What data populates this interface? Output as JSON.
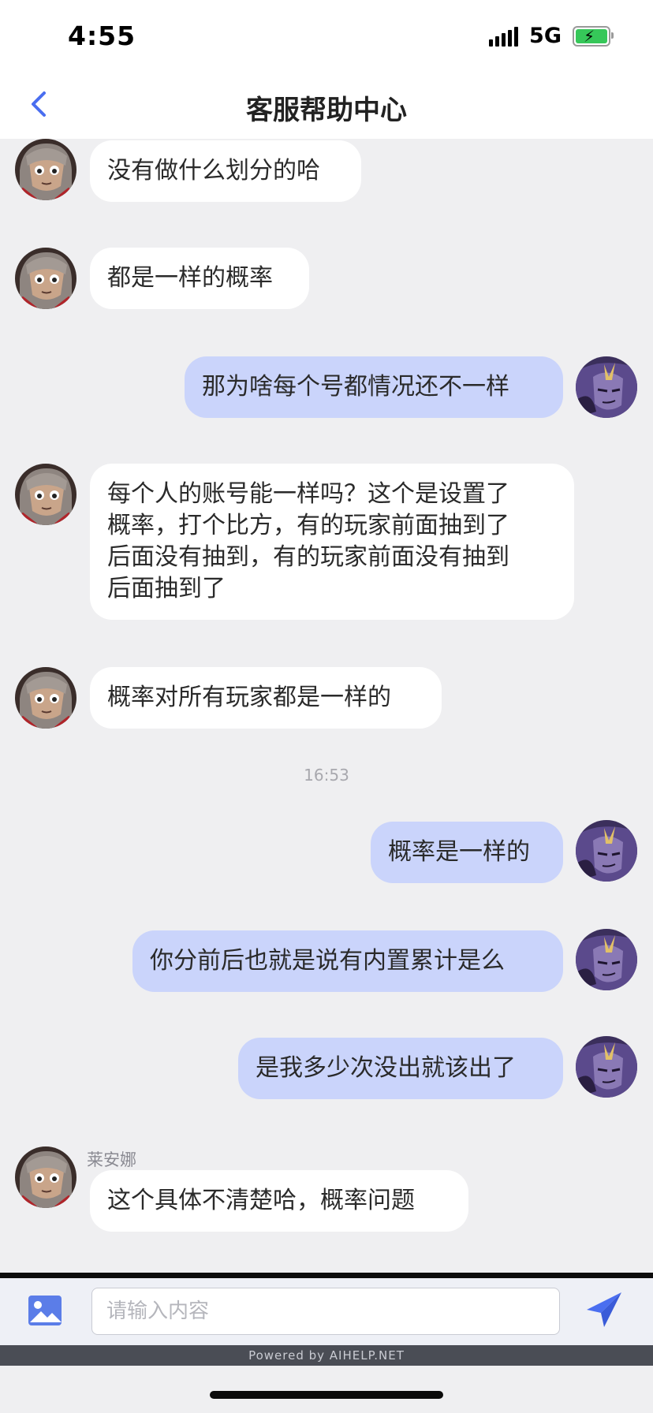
{
  "status_bar": {
    "time": "4:55",
    "network": "5G"
  },
  "nav": {
    "title": "客服帮助中心"
  },
  "messages": [
    {
      "side": "agent",
      "text": "没有做什么划分的哈"
    },
    {
      "side": "agent",
      "text": "都是一样的概率"
    },
    {
      "side": "user",
      "text": "那为啥每个号都情况还不一样"
    },
    {
      "side": "agent",
      "text": "每个人的账号能一样吗？这个是设置了\n概率，打个比方，有的玩家前面抽到了\n后面没有抽到，有的玩家前面没有抽到\n后面抽到了"
    },
    {
      "side": "agent",
      "text": "概率对所有玩家都是一样的"
    },
    {
      "side": "user",
      "text": "概率是一样的"
    },
    {
      "side": "user",
      "text": "你分前后也就是说有内置累计是么"
    },
    {
      "side": "user",
      "text": "是我多少次没出就该出了"
    },
    {
      "side": "agent",
      "sender": "莱安娜",
      "text": "这个具体不清楚哈，概率问题"
    }
  ],
  "time_separator": "16:53",
  "input": {
    "placeholder": "请输入内容"
  },
  "footer": {
    "powered_by": "Powered by AIHELP.NET"
  },
  "colors": {
    "user_bubble": "#cad4fb",
    "agent_bubble": "#ffffff",
    "accent": "#4a6ef0"
  }
}
